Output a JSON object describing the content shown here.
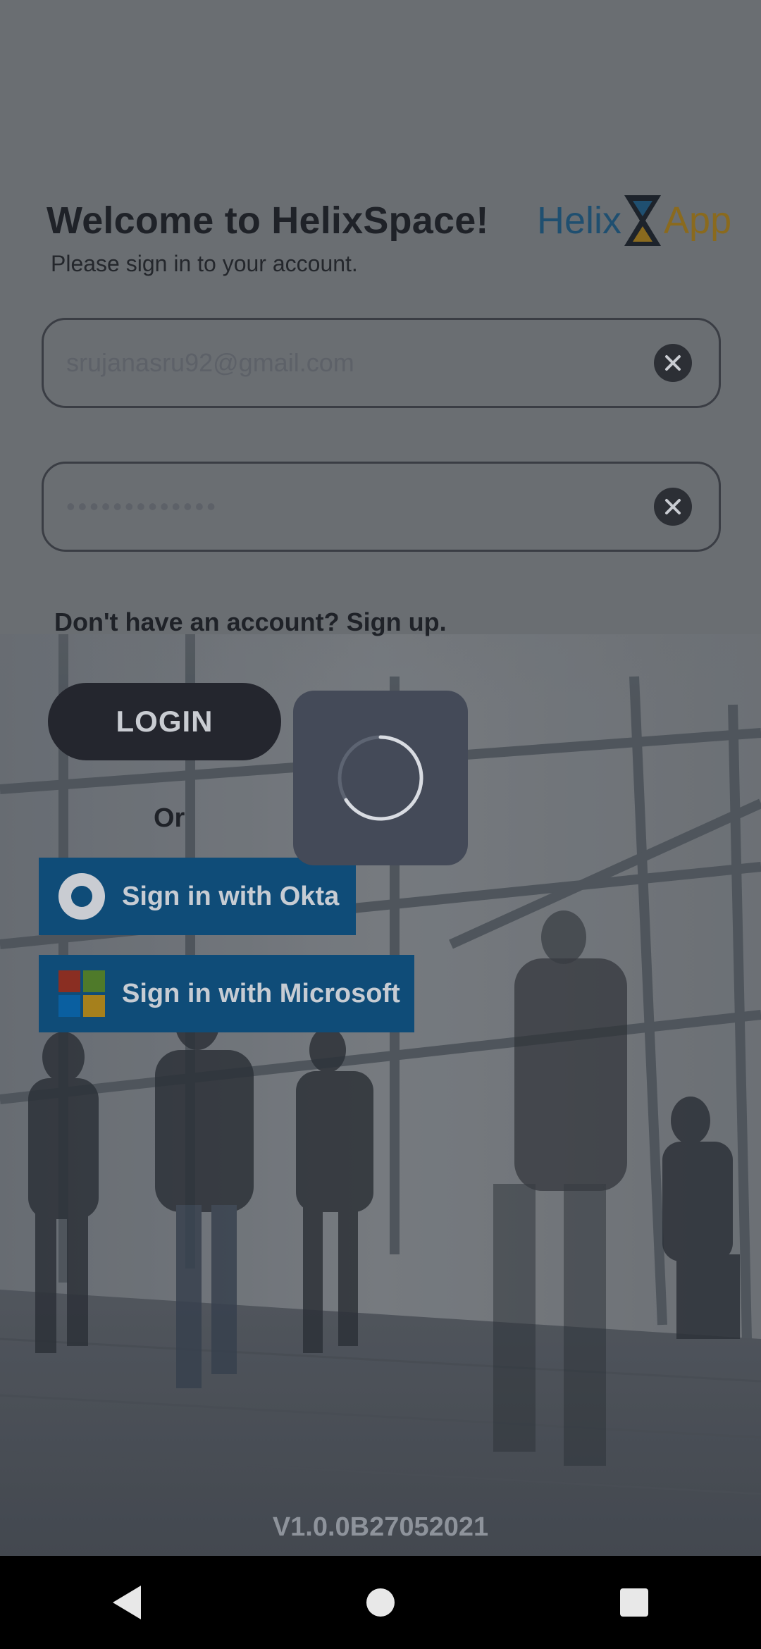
{
  "header": {
    "title": "Welcome to HelixSpace!",
    "subtitle": "Please sign in to your account.",
    "logo": {
      "left_text": "Helix",
      "right_text": "App",
      "icon": "hourglass-icon"
    }
  },
  "form": {
    "email_value": "srujanasru92@gmail.com",
    "password_value": "•••••••••••••",
    "clear_icon": "close-circle-icon"
  },
  "signup_text": "Don't have an account? Sign up.",
  "login_label": "LOGIN",
  "or_text": "Or",
  "sso": {
    "okta_label": "Sign in with Okta",
    "microsoft_label": "Sign in with Microsoft"
  },
  "loading": {
    "icon": "spinner-icon"
  },
  "version": "V1.0.0B27052021",
  "colors": {
    "button_dark": "#24262e",
    "sso_blue": "#0f4c78",
    "ms_red": "#8a2e22",
    "ms_green": "#4f7a2a",
    "ms_blue": "#0a5fa0",
    "ms_yellow": "#a6801c"
  },
  "navbar": {
    "back_icon": "back-triangle-icon",
    "home_icon": "home-circle-icon",
    "recents_icon": "recents-square-icon"
  }
}
